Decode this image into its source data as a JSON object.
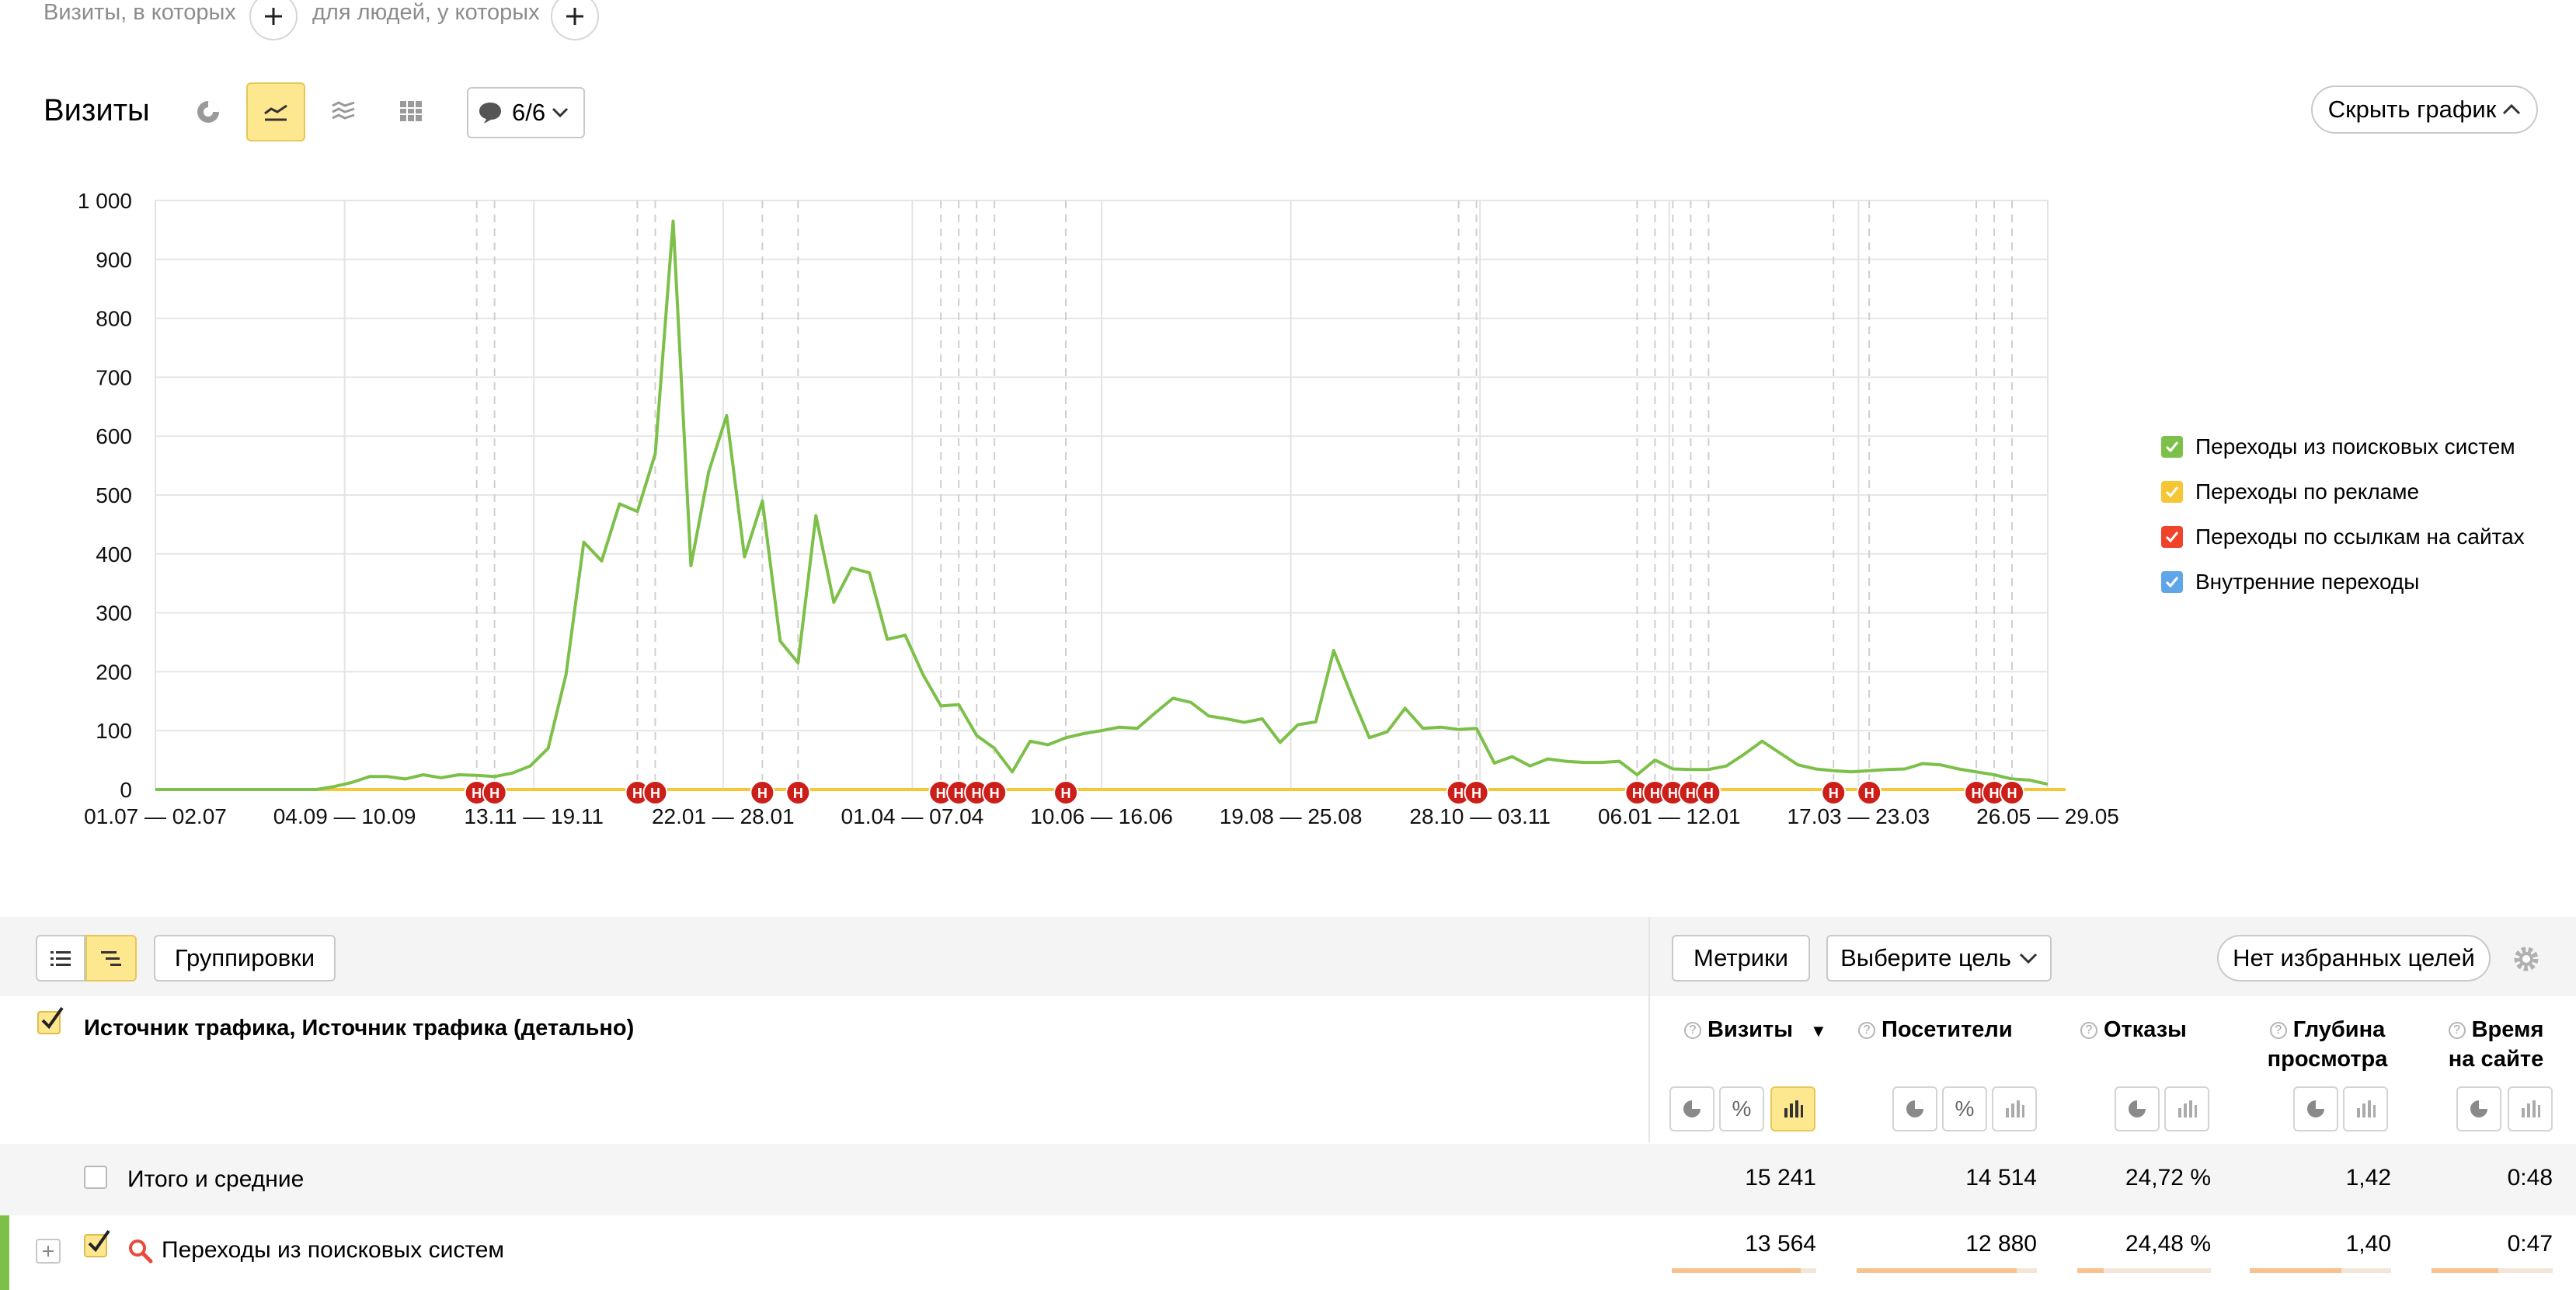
{
  "segments": {
    "visits_text": "Визиты, в которых",
    "people_text": "для людей, у которых"
  },
  "report": {
    "title": "Визиты",
    "annotations_count": "6/6",
    "hide_chart_label": "Скрыть график"
  },
  "chart_data": {
    "type": "line",
    "title": "",
    "xlabel": "",
    "ylabel": "",
    "ylim": [
      0,
      1000
    ],
    "yticks": [
      "1 000",
      "900",
      "800",
      "700",
      "600",
      "500",
      "400",
      "300",
      "200",
      "100",
      "0"
    ],
    "xtick_labels": [
      "01.07 — 02.07",
      "04.09 — 10.09",
      "13.11 — 19.11",
      "22.01 — 28.01",
      "01.04 — 07.04",
      "10.06 — 16.06",
      "19.08 — 25.08",
      "28.10 — 03.11",
      "06.01 — 12.01",
      "17.03 — 23.03",
      "26.05 — 29.05"
    ],
    "grid": true,
    "legend_position": "right",
    "series": [
      {
        "name": "Переходы из поисковых систем",
        "color": "#7cc04a",
        "values": [
          0,
          0,
          0,
          0,
          0,
          0,
          0,
          0,
          0,
          0,
          5,
          12,
          22,
          22,
          18,
          25,
          20,
          25,
          24,
          22,
          28,
          40,
          70,
          195,
          420,
          388,
          485,
          472,
          570,
          965,
          380,
          540,
          635,
          395,
          490,
          252,
          215,
          465,
          318,
          376,
          368,
          255,
          262,
          195,
          142,
          144,
          92,
          70,
          30,
          82,
          76,
          88,
          95,
          100,
          106,
          104,
          130,
          155,
          148,
          125,
          120,
          114,
          120,
          80,
          110,
          115,
          236,
          160,
          88,
          98,
          138,
          104,
          106,
          102,
          104,
          45,
          56,
          40,
          52,
          48,
          46,
          46,
          48,
          25,
          50,
          35,
          34,
          34,
          40,
          60,
          82,
          62,
          42,
          35,
          32,
          30,
          32,
          34,
          35,
          44,
          42,
          35,
          30,
          25,
          18,
          16,
          9
        ]
      },
      {
        "name": "Переходы по рекламе",
        "color": "#f6c634",
        "values": [
          0,
          0,
          0,
          0,
          0,
          0,
          0,
          0,
          0,
          0,
          0,
          0,
          0,
          0,
          0,
          0,
          0,
          0,
          0,
          0,
          0,
          0,
          0,
          0,
          0,
          0,
          0,
          0,
          0,
          0,
          0,
          0,
          0,
          0,
          0,
          0,
          0,
          0,
          0,
          0,
          0,
          0,
          0,
          0,
          0,
          0,
          0,
          0,
          0,
          0,
          0,
          0,
          0,
          0,
          0,
          0,
          0,
          0,
          0,
          0,
          0,
          0,
          0,
          0,
          0,
          0,
          0,
          0,
          0,
          0,
          0,
          0,
          0,
          0,
          0,
          0,
          0,
          0,
          0,
          0,
          0,
          0,
          0,
          0,
          0,
          0,
          0,
          0,
          0,
          0,
          0,
          0,
          0,
          0,
          0,
          0,
          0,
          0,
          0,
          0,
          0,
          0,
          0,
          0,
          0,
          0,
          0,
          0
        ]
      },
      {
        "name": "Переходы по ссылкам на сайтах",
        "color": "#f0432b",
        "values": [
          0,
          0,
          0,
          0,
          0,
          0,
          0,
          0,
          0,
          0,
          0,
          0,
          0,
          0,
          0,
          0,
          0,
          0,
          0,
          0,
          0,
          0,
          0,
          0,
          0,
          0,
          0,
          0,
          0,
          0,
          0,
          0,
          0,
          0,
          0,
          0,
          0,
          0,
          0,
          0,
          0,
          0,
          0,
          0,
          0,
          0,
          0,
          0,
          0,
          0,
          0,
          0,
          0,
          0,
          0,
          0,
          0,
          0,
          0,
          0,
          0,
          0,
          0,
          0,
          0,
          0,
          0,
          0,
          0,
          0,
          0,
          0,
          0,
          0,
          0,
          0,
          0,
          0,
          0,
          0,
          0,
          0,
          0,
          0,
          0,
          0,
          0,
          0,
          0,
          0,
          0,
          0,
          0,
          0,
          0,
          0,
          0,
          0,
          0,
          0,
          0,
          0,
          0,
          0,
          0,
          0,
          0,
          0
        ]
      },
      {
        "name": "Внутренние переходы",
        "color": "#5fa6e8",
        "values": [
          0,
          0,
          0,
          0,
          0,
          0,
          0,
          0,
          0,
          0,
          0,
          0,
          0,
          0,
          0,
          0,
          0,
          0,
          0,
          0,
          0,
          0,
          0,
          0,
          0,
          0,
          0,
          0,
          0,
          0,
          0,
          0,
          0,
          0,
          0,
          0,
          0,
          0,
          0,
          0,
          0,
          0,
          0,
          0,
          0,
          0,
          0,
          0,
          0,
          0,
          0,
          0,
          0,
          0,
          0,
          0,
          0,
          0,
          0,
          0,
          0,
          0,
          0,
          0,
          0,
          0,
          0,
          0,
          0,
          0,
          0,
          0,
          0,
          0,
          0,
          0,
          0,
          0,
          0,
          0,
          0,
          0,
          0,
          0,
          0,
          0,
          0,
          0,
          0,
          0,
          0,
          0,
          0,
          0,
          0,
          0,
          0,
          0,
          0,
          0,
          0,
          0,
          0,
          0,
          0,
          0,
          0,
          0
        ]
      }
    ],
    "annotation_label": "Н",
    "annotation_x_index": [
      18,
      19,
      27,
      28,
      34,
      36,
      44,
      45,
      46,
      47,
      51,
      73,
      74,
      83,
      84,
      85,
      86,
      87,
      94,
      96,
      102,
      103,
      104
    ]
  },
  "toolbar": {
    "groupings_label": "Группировки",
    "metrics_label": "Метрики",
    "goal_label": "Выберите цель",
    "favorites_label": "Нет избранных целей"
  },
  "table": {
    "dimension_header": "Источник трафика, Источник трафика (детально)",
    "columns": [
      {
        "line1": "Визиты",
        "line2": "",
        "sort": "▼"
      },
      {
        "line1": "Посетители",
        "line2": ""
      },
      {
        "line1": "Отказы",
        "line2": ""
      },
      {
        "line1": "Глубина",
        "line2": "просмотра"
      },
      {
        "line1": "Время",
        "line2": "на сайте"
      }
    ],
    "totals": {
      "label": "Итого и средние",
      "values": [
        "15 241",
        "14 514",
        "24,72 %",
        "1,42",
        "0:48"
      ]
    },
    "rows": [
      {
        "label": "Переходы из поисковых систем",
        "values": [
          "13 564",
          "12 880",
          "24,48 %",
          "1,40",
          "0:47"
        ],
        "bars": [
          0.89,
          0.89,
          0.2,
          0.65,
          0.55
        ]
      }
    ]
  }
}
